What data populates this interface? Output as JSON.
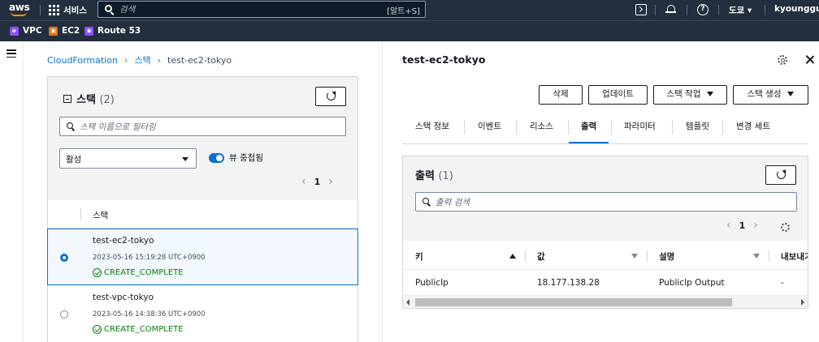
{
  "topnav": {
    "logo": "aws",
    "services_label": "서비스",
    "search_placeholder": "검색",
    "search_shortcut": "[알트+S]",
    "region": "도쿄 ▾",
    "user": "kyounggu ▾"
  },
  "favorites": [
    {
      "label": "VPC",
      "color": "#8c4fff"
    },
    {
      "label": "EC2",
      "color": "#ed7100"
    },
    {
      "label": "Route 53",
      "color": "#8c4fff"
    }
  ],
  "breadcrumb": {
    "root": "CloudFormation",
    "mid": "스택",
    "current": "test-ec2-tokyo"
  },
  "stacks_panel": {
    "title": "스택",
    "count": "(2)",
    "filter_placeholder": "스택 이름으로 필터링",
    "status_select": "활성",
    "toggle_label": "뷰 중첩됨",
    "page": "1",
    "column_header": "스택",
    "rows": [
      {
        "name": "test-ec2-tokyo",
        "time": "2023-05-16 15:19:28 UTC+0900",
        "status": "CREATE_COMPLETE",
        "selected": true
      },
      {
        "name": "test-vpc-tokyo",
        "time": "2023-05-16 14:38:36 UTC+0900",
        "status": "CREATE_COMPLETE",
        "selected": false
      }
    ]
  },
  "detail": {
    "title": "test-ec2-tokyo",
    "buttons": {
      "delete": "삭제",
      "update": "업데이트",
      "stack_actions": "스택 작업",
      "create_stack": "스택 생성"
    },
    "tabs": [
      "스택 정보",
      "이벤트",
      "리소스",
      "출력",
      "파라미터",
      "템플릿",
      "변경 세트"
    ],
    "active_tab": "출력"
  },
  "outputs": {
    "title": "출력",
    "count": "(1)",
    "search_placeholder": "출력 검색",
    "page": "1",
    "columns": [
      "키",
      "값",
      "설명",
      "내보내기"
    ],
    "rows": [
      {
        "key": "PublicIp",
        "value": "18.177.138.28",
        "description": "PublicIp Output",
        "export": "-"
      }
    ]
  },
  "colors": {
    "nav_bg": "#232f3e",
    "accent": "#0972d3",
    "success": "#037f0c"
  }
}
